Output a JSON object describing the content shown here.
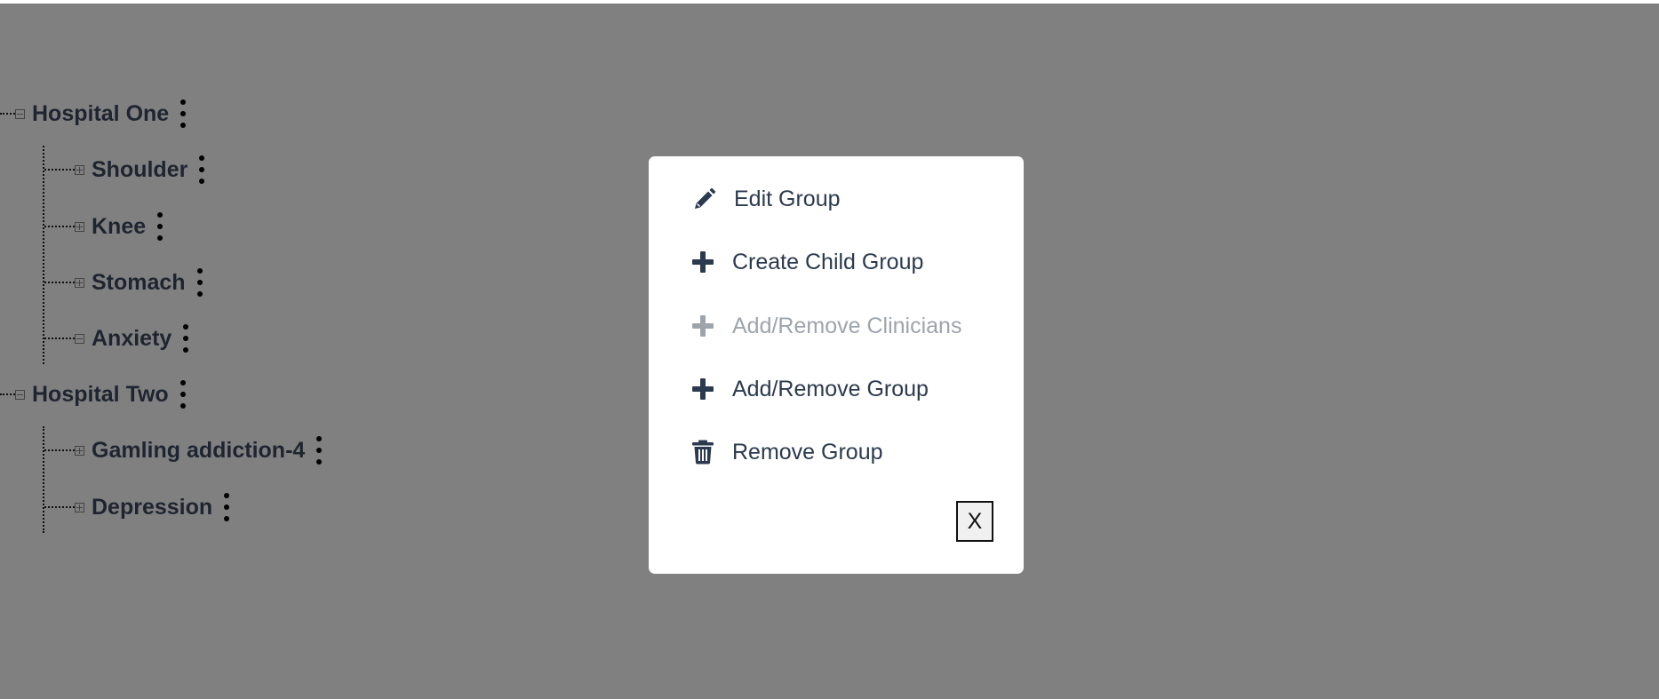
{
  "tree": {
    "nodes": [
      {
        "label": "Hospital One",
        "state": "expanded"
      },
      {
        "label": "Shoulder",
        "state": "collapsed"
      },
      {
        "label": "Knee",
        "state": "collapsed"
      },
      {
        "label": "Stomach",
        "state": "collapsed"
      },
      {
        "label": "Anxiety",
        "state": "expanded"
      },
      {
        "label": "Hospital Two",
        "state": "expanded"
      },
      {
        "label": "Gamling addiction-4",
        "state": "collapsed"
      },
      {
        "label": "Depression",
        "state": "collapsed"
      }
    ]
  },
  "modal": {
    "items": [
      {
        "label": "Edit Group",
        "icon": "pencil-icon",
        "enabled": true
      },
      {
        "label": "Create Child Group",
        "icon": "plus-icon",
        "enabled": true
      },
      {
        "label": "Add/Remove Clinicians",
        "icon": "plus-icon",
        "enabled": false
      },
      {
        "label": "Add/Remove Group",
        "icon": "plus-icon",
        "enabled": true
      },
      {
        "label": "Remove Group",
        "icon": "trash-icon",
        "enabled": true
      }
    ],
    "close_label": "X"
  },
  "colors": {
    "backdrop": "#808080",
    "modal_bg": "#ffffff",
    "menu_text": "#2b3a4e",
    "menu_text_disabled": "#9ea4ac",
    "tree_text": "#1f2530"
  }
}
